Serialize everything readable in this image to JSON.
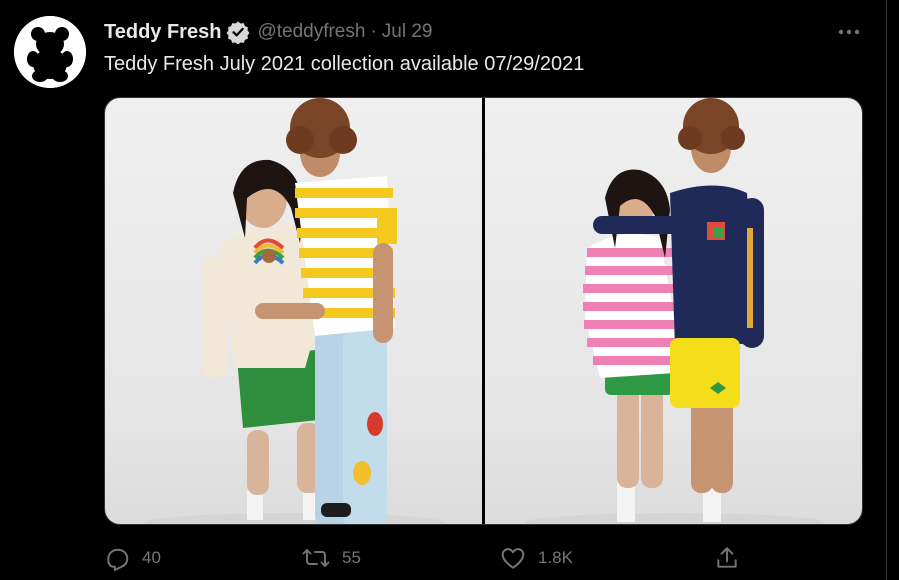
{
  "tweet": {
    "display_name": "Teddy Fresh",
    "handle": "@teddyfresh",
    "separator": "·",
    "date": "Jul 29",
    "text": "Teddy Fresh July 2021 collection available 07/29/2021",
    "verified": true,
    "avatar_icon": "teddy-bear-silhouette-icon",
    "media_count": 2
  },
  "actions": {
    "reply_count": "40",
    "retweet_count": "55",
    "like_count": "1.8K"
  },
  "colors": {
    "background": "#000000",
    "text_primary": "#e7e9ea",
    "text_secondary": "#71767b",
    "border": "#2f3336",
    "photo_background": "#e9e9ea"
  },
  "icons": [
    "verified-badge-icon",
    "more-options-icon",
    "reply-icon",
    "retweet-icon",
    "like-icon",
    "share-icon"
  ]
}
